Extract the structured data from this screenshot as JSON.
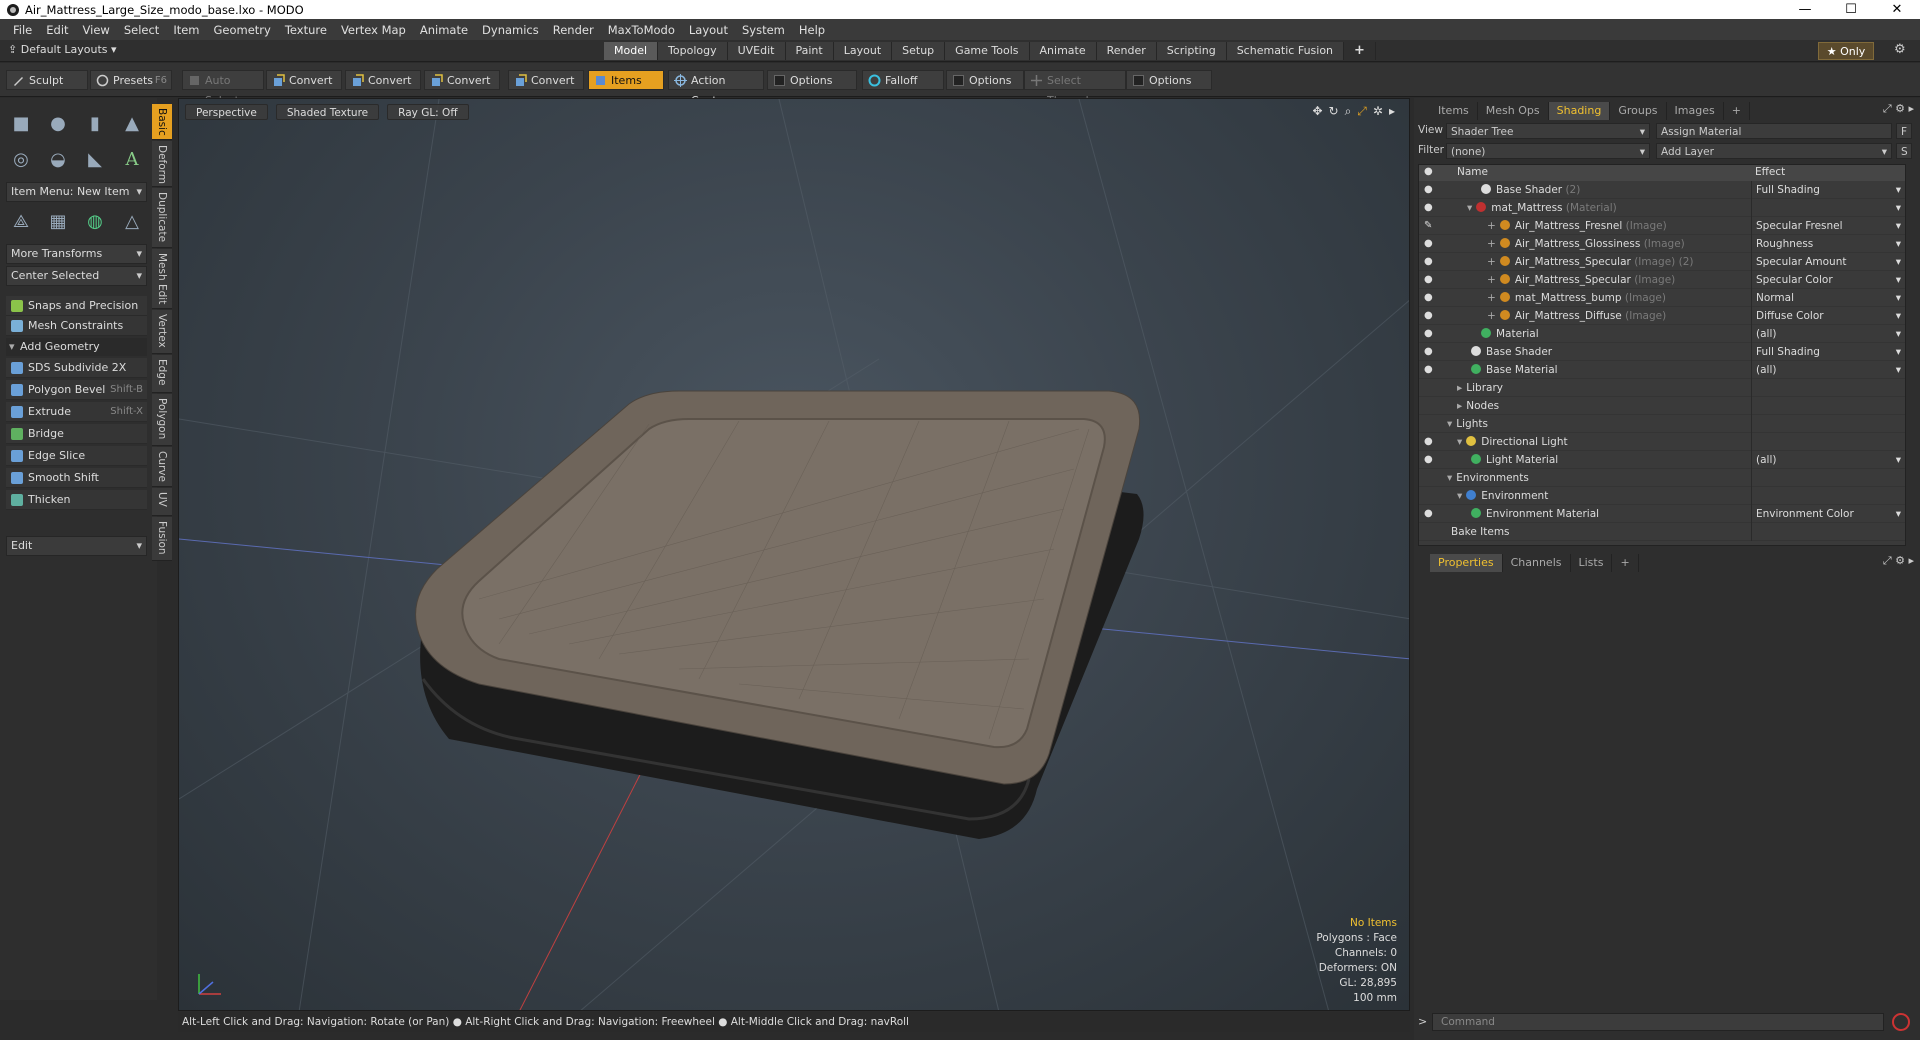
{
  "window": {
    "title": "Air_Mattress_Large_Size_modo_base.lxo - MODO",
    "min": "—",
    "max": "☐",
    "close": "✕"
  },
  "menubar": [
    "File",
    "Edit",
    "View",
    "Select",
    "Item",
    "Geometry",
    "Texture",
    "Vertex Map",
    "Animate",
    "Dynamics",
    "Render",
    "MaxToModo",
    "Layout",
    "System",
    "Help"
  ],
  "layoutbar": {
    "default_layouts": "Default Layouts ▾",
    "tabs": [
      "Model",
      "Topology",
      "UVEdit",
      "Paint",
      "Layout",
      "Setup",
      "Game Tools",
      "Animate",
      "Render",
      "Scripting",
      "Schematic Fusion"
    ],
    "active_tab": "Model",
    "plus": "+",
    "only": "★  Only",
    "gear": "⚙"
  },
  "toolbar": {
    "sculpt": "Sculpt",
    "presets": "Presets",
    "presets_key": "F6",
    "auto_select": "Auto Select",
    "convert1": "Convert",
    "convert2": "Convert",
    "convert3": "Convert",
    "convert4": "Convert",
    "items": "Items",
    "action_center": "Action Center",
    "options1": "Options",
    "falloff": "Falloff",
    "options2": "Options",
    "select_through": "Select Through",
    "options3": "Options"
  },
  "left": {
    "item_menu": "Item Menu: New Item",
    "more_transforms": "More Transforms",
    "center_selected": "Center Selected",
    "snaps": "Snaps and Precision",
    "mesh_constraints": "Mesh Constraints",
    "add_geometry": "Add Geometry",
    "tools": [
      {
        "label": "SDS Subdivide 2X",
        "key": ""
      },
      {
        "label": "Polygon Bevel",
        "key": "Shift-B"
      },
      {
        "label": "Extrude",
        "key": "Shift-X"
      },
      {
        "label": "Bridge",
        "key": ""
      },
      {
        "label": "Edge Slice",
        "key": ""
      },
      {
        "label": "Smooth Shift",
        "key": ""
      },
      {
        "label": "Thicken",
        "key": ""
      }
    ],
    "edit": "Edit",
    "vtabs": [
      "Basic",
      "Deform",
      "Duplicate",
      "Mesh Edit",
      "Vertex",
      "Edge",
      "Polygon",
      "Curve",
      "UV",
      "Fusion"
    ]
  },
  "viewport": {
    "perspective": "Perspective",
    "shading": "Shaded Texture",
    "raygl": "Ray GL: Off",
    "info": {
      "no_items": "No Items",
      "polygons": "Polygons : Face",
      "channels": "Channels: 0",
      "deformers": "Deformers: ON",
      "gl": "GL: 28,895",
      "scale": "100 mm"
    }
  },
  "rpanel": {
    "tabs": [
      "Items",
      "Mesh Ops",
      "Shading",
      "Groups",
      "Images"
    ],
    "active_tab": "Shading",
    "plus": "+",
    "view_label": "View",
    "view_value": "Shader Tree",
    "assign_material": "Assign Material",
    "f_btn": "F",
    "filter_label": "Filter",
    "filter_value": "(none)",
    "add_layer": "Add Layer",
    "s_btn": "S",
    "col_name": "Name",
    "col_effect": "Effect",
    "rows": [
      {
        "name": "Base Shader",
        "sub": "(2)",
        "effect": "Full Shading",
        "indent": 3,
        "eye": "●",
        "color": "#dddddd",
        "tw": "",
        "dd": true
      },
      {
        "name": "mat_Mattress",
        "sub": "(Material)",
        "effect": "",
        "indent": 2,
        "eye": "●",
        "color": "#c03030",
        "tw": "▾",
        "dd": true
      },
      {
        "name": "Air_Mattress_Fresnel",
        "sub": "(Image)",
        "effect": "Specular Fresnel",
        "indent": 4,
        "eye": "✎",
        "color": "#d08a20",
        "tw": "+",
        "dd": true
      },
      {
        "name": "Air_Mattress_Glossiness",
        "sub": "(Image)",
        "effect": "Roughness",
        "indent": 4,
        "eye": "●",
        "color": "#d08a20",
        "tw": "+",
        "dd": true
      },
      {
        "name": "Air_Mattress_Specular",
        "sub": "(Image) (2)",
        "effect": "Specular Amount",
        "indent": 4,
        "eye": "●",
        "color": "#d08a20",
        "tw": "+",
        "dd": true
      },
      {
        "name": "Air_Mattress_Specular",
        "sub": "(Image)",
        "effect": "Specular Color",
        "indent": 4,
        "eye": "●",
        "color": "#d08a20",
        "tw": "+",
        "dd": true
      },
      {
        "name": "mat_Mattress_bump",
        "sub": "(Image)",
        "effect": "Normal",
        "indent": 4,
        "eye": "●",
        "color": "#d08a20",
        "tw": "+",
        "dd": true
      },
      {
        "name": "Air_Mattress_Diffuse",
        "sub": "(Image)",
        "effect": "Diffuse Color",
        "indent": 4,
        "eye": "●",
        "color": "#d08a20",
        "tw": "+",
        "dd": true
      },
      {
        "name": "Material",
        "sub": "",
        "effect": "(all)",
        "indent": 3,
        "eye": "●",
        "color": "#40b060",
        "tw": "",
        "dd": true
      },
      {
        "name": "Base Shader",
        "sub": "",
        "effect": "Full Shading",
        "indent": 2,
        "eye": "●",
        "color": "#dddddd",
        "tw": "",
        "dd": true
      },
      {
        "name": "Base Material",
        "sub": "",
        "effect": "(all)",
        "indent": 2,
        "eye": "●",
        "color": "#40b060",
        "tw": "",
        "dd": true
      },
      {
        "name": "Library",
        "sub": "",
        "effect": "",
        "indent": 1,
        "eye": "",
        "color": "",
        "tw": "▸",
        "dd": false
      },
      {
        "name": "Nodes",
        "sub": "",
        "effect": "",
        "indent": 1,
        "eye": "",
        "color": "",
        "tw": "▸",
        "dd": false
      },
      {
        "name": "Lights",
        "sub": "",
        "effect": "",
        "indent": 0,
        "eye": "",
        "color": "",
        "tw": "▾",
        "dd": false
      },
      {
        "name": "Directional Light",
        "sub": "",
        "effect": "",
        "indent": 1,
        "eye": "●",
        "color": "#e0c040",
        "tw": "▾",
        "dd": false
      },
      {
        "name": "Light Material",
        "sub": "",
        "effect": "(all)",
        "indent": 2,
        "eye": "●",
        "color": "#40b060",
        "tw": "",
        "dd": true
      },
      {
        "name": "Environments",
        "sub": "",
        "effect": "",
        "indent": 0,
        "eye": "",
        "color": "",
        "tw": "▾",
        "dd": false
      },
      {
        "name": "Environment",
        "sub": "",
        "effect": "",
        "indent": 1,
        "eye": "",
        "color": "#4080d0",
        "tw": "▾",
        "dd": false
      },
      {
        "name": "Environment Material",
        "sub": "",
        "effect": "Environment Color",
        "indent": 2,
        "eye": "●",
        "color": "#40b060",
        "tw": "",
        "dd": true
      },
      {
        "name": "Bake Items",
        "sub": "",
        "effect": "",
        "indent": 0,
        "eye": "",
        "color": "",
        "tw": "",
        "dd": false
      }
    ],
    "ptabs": [
      "Properties",
      "Channels",
      "Lists"
    ],
    "ptabs_active": "Properties"
  },
  "status": "Alt-Left Click and Drag: Navigation: Rotate (or Pan) ● Alt-Right Click and Drag: Navigation: Freewheel ● Alt-Middle Click and Drag: navRoll",
  "command_placeholder": "Command"
}
